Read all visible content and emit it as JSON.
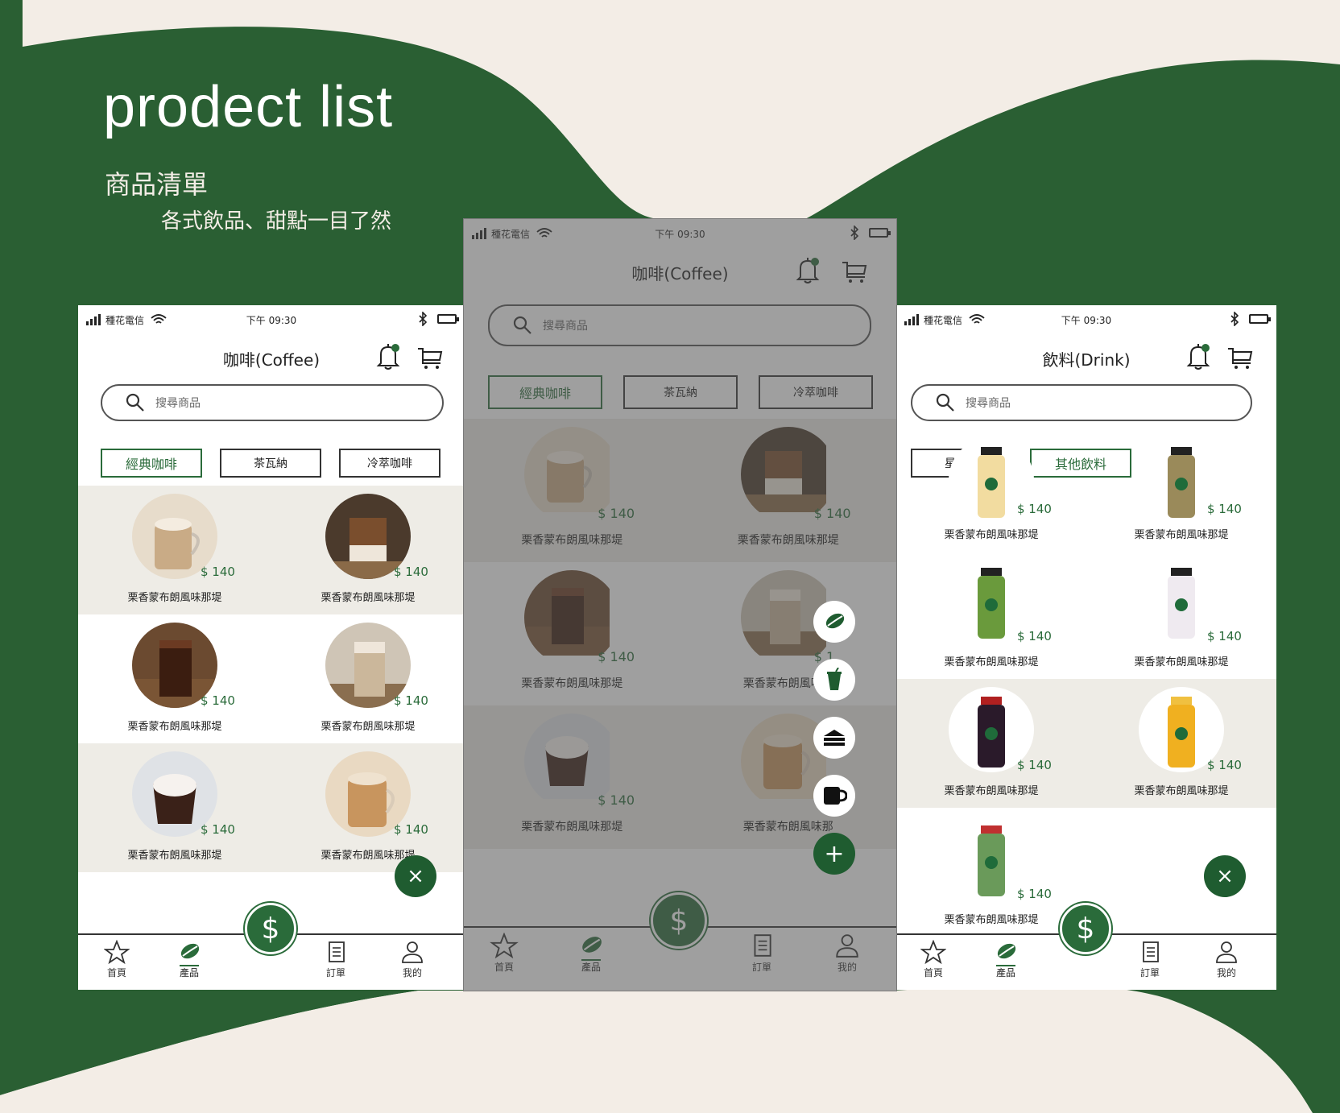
{
  "hero": {
    "title": "prodect list",
    "subtitle": "商品清單",
    "tagline": "各式飲品、甜點一目了然"
  },
  "colors": {
    "brand": "#2a6b3a",
    "bg": "#f3ede6",
    "wave": "#2a5f33"
  },
  "status": {
    "carrier": "種花電信",
    "time": "下午 09:30"
  },
  "phones": {
    "left": {
      "title": "咖啡(Coffee)",
      "search_placeholder": "搜尋商品",
      "chips": [
        "經典咖啡",
        "茶瓦納",
        "冷萃咖啡"
      ],
      "active_chip": 0,
      "products": [
        {
          "price": "$ 140",
          "name": "栗香蒙布朗風味那堤",
          "img": "latte"
        },
        {
          "price": "$ 140",
          "name": "栗香蒙布朗風味那堤",
          "img": "dalgona"
        },
        {
          "price": "$ 140",
          "name": "栗香蒙布朗風味那堤",
          "img": "iced-americano"
        },
        {
          "price": "$ 140",
          "name": "栗香蒙布朗風味那堤",
          "img": "iced-latte"
        },
        {
          "price": "$ 140",
          "name": "栗香蒙布朗風味那堤",
          "img": "macchiato"
        },
        {
          "price": "$ 140",
          "name": "栗香蒙布朗風味那堤",
          "img": "cappuccino"
        }
      ]
    },
    "middle": {
      "title": "咖啡(Coffee)",
      "search_placeholder": "搜尋商品",
      "chips": [
        "經典咖啡",
        "茶瓦納",
        "冷萃咖啡"
      ],
      "products": [
        {
          "price": "$ 140",
          "name": "栗香蒙布朗風味那堤",
          "img": "latte"
        },
        {
          "price": "$ 140",
          "name": "栗香蒙布朗風味那堤",
          "img": "dalgona"
        },
        {
          "price": "$ 140",
          "name": "栗香蒙布朗風味那堤",
          "img": "iced-americano"
        },
        {
          "price": "$ 1",
          "name": "栗香蒙布朗風味那",
          "img": "iced-latte"
        },
        {
          "price": "$ 140",
          "name": "栗香蒙布朗風味那堤",
          "img": "macchiato"
        },
        {
          "price": "$ 1",
          "name": "栗香蒙布朗風味那",
          "img": "cappuccino"
        }
      ]
    },
    "right": {
      "title": "飲料(Drink)",
      "search_placeholder": "搜尋商品",
      "chips": [
        "星冰樂",
        "其他飲料"
      ],
      "active_chip": 1,
      "products": [
        {
          "price": "$ 140",
          "name": "栗香蒙布朗風味那堤",
          "img": "bottle-cream"
        },
        {
          "price": "$ 140",
          "name": "栗香蒙布朗風味那堤",
          "img": "bottle-small"
        },
        {
          "price": "$ 140",
          "name": "栗香蒙布朗風味那堤",
          "img": "bottle-green"
        },
        {
          "price": "$ 140",
          "name": "栗香蒙布朗風味那堤",
          "img": "bottle-white"
        },
        {
          "price": "$ 140",
          "name": "栗香蒙布朗風味那堤",
          "img": "bottle-dark"
        },
        {
          "price": "$ 140",
          "name": "栗香蒙布朗風味那堤",
          "img": "bottle-orange"
        },
        {
          "price": "$ 140",
          "name": "栗香蒙布朗風味那堤",
          "img": "bottle-glass"
        }
      ]
    }
  },
  "tabs": {
    "home": "首頁",
    "products": "產品",
    "orders": "訂單",
    "mine": "我的"
  },
  "icons": {
    "pay": "$",
    "close": "×",
    "add": "+"
  }
}
